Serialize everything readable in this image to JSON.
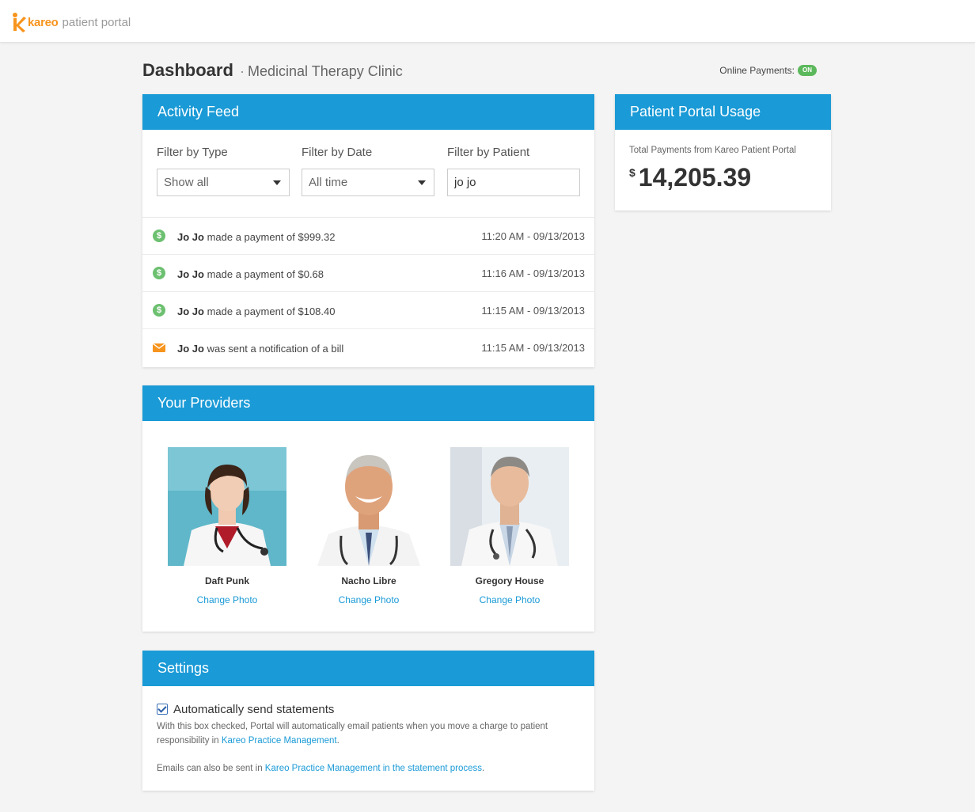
{
  "header": {
    "brand": "kareo",
    "product": "patient portal"
  },
  "page": {
    "title": "Dashboard",
    "separator": "·",
    "subtitle": "Medicinal Therapy Clinic",
    "online_payments_label": "Online Payments:",
    "online_payments_status": "ON"
  },
  "activity": {
    "title": "Activity Feed",
    "filter_type_label": "Filter by Type",
    "filter_type_value": "Show all",
    "filter_date_label": "Filter by Date",
    "filter_date_value": "All time",
    "filter_patient_label": "Filter by Patient",
    "filter_patient_value": "jo jo",
    "items": [
      {
        "icon": "dollar-icon",
        "name": "Jo Jo",
        "text": " made a payment of $999.32",
        "time": "11:20 AM - 09/13/2013"
      },
      {
        "icon": "dollar-icon",
        "name": "Jo Jo",
        "text": " made a payment of $0.68",
        "time": "11:16 AM - 09/13/2013"
      },
      {
        "icon": "dollar-icon",
        "name": "Jo Jo",
        "text": " made a payment of $108.40",
        "time": "11:15 AM - 09/13/2013"
      },
      {
        "icon": "envelope-icon",
        "name": "Jo Jo",
        "text": " was sent a notification of a bill",
        "time": "11:15 AM - 09/13/2013"
      }
    ]
  },
  "providers": {
    "title": "Your Providers",
    "items": [
      {
        "name": "Daft Punk",
        "link": "Change Photo"
      },
      {
        "name": "Nacho Libre",
        "link": "Change Photo"
      },
      {
        "name": "Gregory House",
        "link": "Change Photo"
      }
    ]
  },
  "settings": {
    "title": "Settings",
    "checkbox_label": "Automatically send statements",
    "desc_text": "With this box checked, Portal will automatically email patients when you move a charge to patient responsibility in ",
    "desc_link": "Kareo Practice Management",
    "desc_end": ".",
    "desc2_text": "Emails can also be sent in ",
    "desc2_link": "Kareo Practice Management in the statement process",
    "desc2_end": "."
  },
  "usage": {
    "title": "Patient Portal Usage",
    "label": "Total Payments from Kareo Patient Portal",
    "currency": "$",
    "amount": "14,205.39"
  },
  "colors": {
    "accent": "#1a9ad6",
    "brand": "#f7941d",
    "success": "#5cb85c"
  }
}
